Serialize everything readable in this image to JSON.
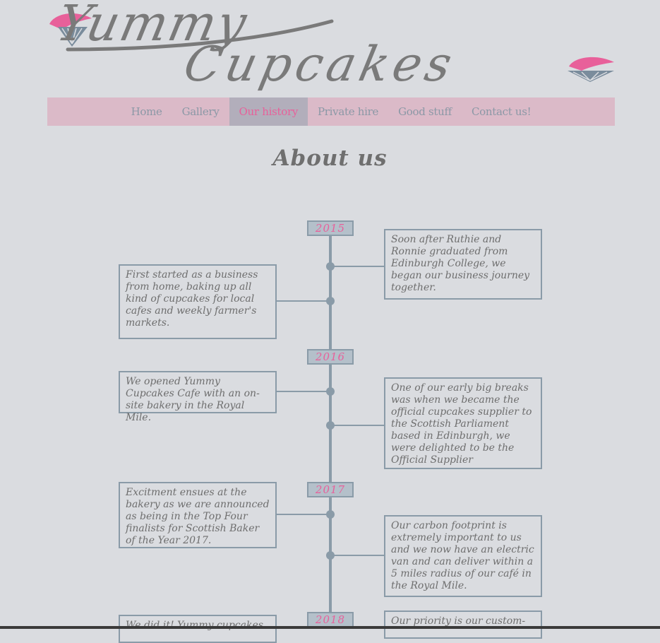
{
  "logo": {
    "line1": "Yummy",
    "line2": "Cupcakes",
    "accent_color": "#e8609a",
    "icon": "cupcake-icon"
  },
  "nav": {
    "items": [
      {
        "label": "Home"
      },
      {
        "label": "Gallery"
      },
      {
        "label": "Our history"
      },
      {
        "label": "Private hire"
      },
      {
        "label": "Good stuff"
      },
      {
        "label": "Contact us!"
      }
    ],
    "active_index": 2
  },
  "page": {
    "title": "About us"
  },
  "timeline": {
    "years": [
      "2015",
      "2016",
      "2017",
      "2018"
    ],
    "entries": [
      {
        "year": "2015",
        "side": "right",
        "text": "Soon after Ruthie and Ronnie graduated from Edinburgh College, we began our business journey together."
      },
      {
        "year": "2015",
        "side": "left",
        "text": "First started as a business from home, baking up all kind of cupcakes for local cafes and weekly farmer's markets."
      },
      {
        "year": "2016",
        "side": "left",
        "text": "We opened Yummy Cupcakes Cafe with an on-site bakery in the Royal Mile."
      },
      {
        "year": "2016",
        "side": "right",
        "text": "One of our early big breaks was when we became the official cupcakes supplier to the Scottish Parliament based in Edinburgh, we were delighted to be the Official Supplier"
      },
      {
        "year": "2017",
        "side": "left",
        "text": "Excitment ensues at the bakery as we are announced as being in the Top Four finalists for Scottish Baker of the Year 2017."
      },
      {
        "year": "2017",
        "side": "right",
        "text": "Our carbon footprint is extremely important to us and we now have an electric van and can deliver within a 5 miles radius of our café in the Royal Mile."
      },
      {
        "year": "2018",
        "side": "left",
        "text": "We did it! Yummy cupcakes"
      },
      {
        "year": "2018",
        "side": "right",
        "text": "Our priority is our custom-"
      }
    ]
  },
  "colors": {
    "background": "#dadce0",
    "nav_background": "#dbbac8",
    "nav_active": "#b2aebb",
    "timeline": "#8a9ba8",
    "text": "#6e6e6e"
  }
}
